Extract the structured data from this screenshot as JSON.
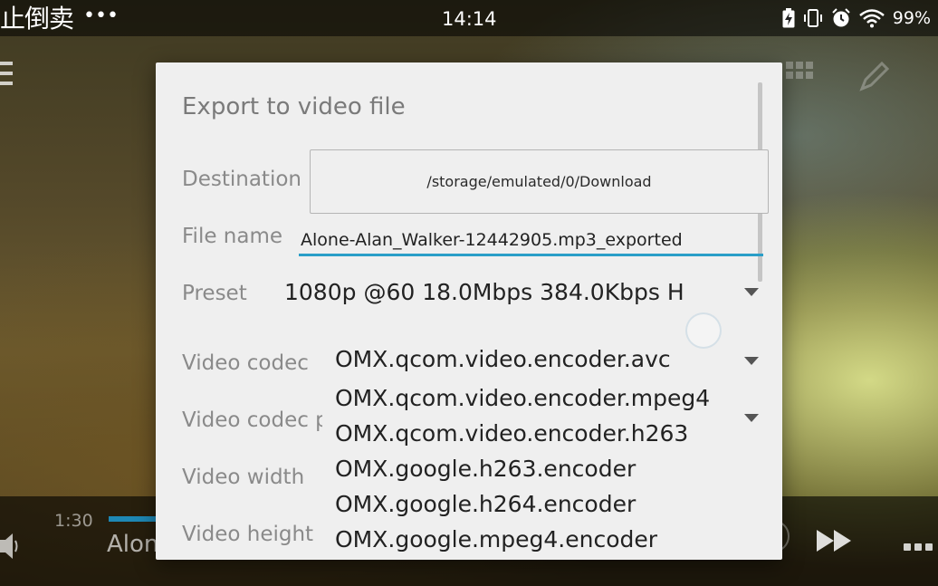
{
  "statusbar": {
    "left_text": "止倒卖",
    "overflow_dots": "•••",
    "time": "14:14",
    "battery_percent": "99%",
    "icons": [
      "battery-charging-icon",
      "vibrate-icon",
      "alarm-icon",
      "wifi-icon"
    ]
  },
  "player": {
    "elapsed": "1:30",
    "track_title": "Alon"
  },
  "dialog": {
    "title": "Export to video file",
    "destination_label": "Destination",
    "destination_value": "/storage/emulated/0/Download",
    "filename_label": "File name",
    "filename_value": "Alone-Alan_Walker-12442905.mp3_exported",
    "preset_label": "Preset",
    "preset_value": "1080p @60 18.0Mbps 384.0Kbps H",
    "video_codec_label": "Video codec",
    "video_codec_value": "OMX.qcom.video.encoder.avc",
    "video_codec_profile_label": "Video codec p",
    "video_width_label": "Video width",
    "video_height_label": "Video height",
    "codec_options": [
      "OMX.qcom.video.encoder.mpeg4",
      "OMX.qcom.video.encoder.h263",
      "OMX.google.h263.encoder",
      "OMX.google.h264.encoder",
      "OMX.google.mpeg4.encoder"
    ]
  },
  "colors": {
    "accent": "#2a9ec8",
    "dialog_bg": "#efefef",
    "label_gray": "#8a8a8a"
  }
}
